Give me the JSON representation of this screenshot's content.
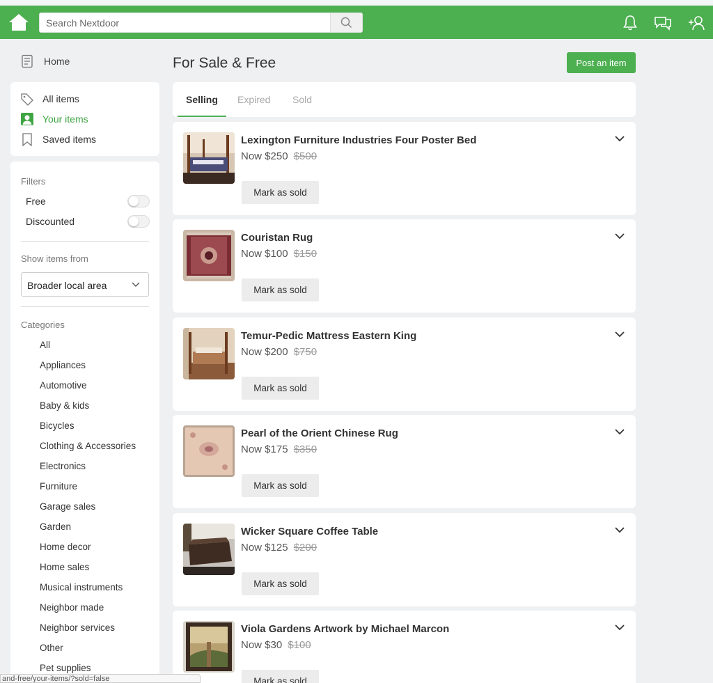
{
  "header": {
    "search_placeholder": "Search Nextdoor"
  },
  "sidebar": {
    "home_label": "Home",
    "items": [
      {
        "label": "All items"
      },
      {
        "label": "Your items"
      },
      {
        "label": "Saved items"
      }
    ],
    "filters_heading": "Filters",
    "filter_free": "Free",
    "filter_discounted": "Discounted",
    "show_items_from": "Show items from",
    "area_selected": "Broader local area",
    "categories_heading": "Categories",
    "categories": [
      "All",
      "Appliances",
      "Automotive",
      "Baby & kids",
      "Bicycles",
      "Clothing & Accessories",
      "Electronics",
      "Furniture",
      "Garage sales",
      "Garden",
      "Home decor",
      "Home sales",
      "Musical instruments",
      "Neighbor made",
      "Neighbor services",
      "Other",
      "Pet supplies"
    ]
  },
  "main": {
    "title": "For Sale & Free",
    "post_button": "Post an item",
    "tabs": [
      {
        "label": "Selling"
      },
      {
        "label": "Expired"
      },
      {
        "label": "Sold"
      }
    ],
    "mark_sold_label": "Mark as sold",
    "listings": [
      {
        "title": "Lexington Furniture Industries Four Poster Bed",
        "now": "Now $250",
        "was": "$500"
      },
      {
        "title": "Couristan Rug",
        "now": "Now $100",
        "was": "$150"
      },
      {
        "title": "Temur-Pedic Mattress Eastern King",
        "now": "Now $200",
        "was": "$750"
      },
      {
        "title": "Pearl of the Orient Chinese Rug",
        "now": "Now $175",
        "was": "$350"
      },
      {
        "title": "Wicker Square Coffee Table",
        "now": "Now $125",
        "was": "$200"
      },
      {
        "title": "Viola Gardens Artwork by Michael Marcon",
        "now": "Now $30",
        "was": "$100"
      }
    ]
  },
  "status_url": "and-free/your-items/?sold=false",
  "colors": {
    "brand_green": "#4caf50",
    "active_green": "#3ea542"
  }
}
